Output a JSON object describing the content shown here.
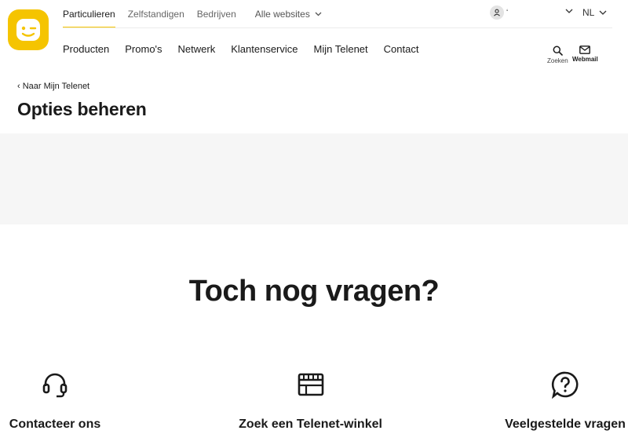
{
  "brand": {
    "accent": "#f5c400",
    "text": "#1a1a1a",
    "band": "#f6f6f6"
  },
  "segments": {
    "items": [
      "Particulieren",
      "Zelfstandigen",
      "Bedrijven"
    ],
    "all_websites": "Alle websites"
  },
  "account": {
    "name": "ʻ"
  },
  "language": "NL",
  "main_nav": [
    "Producten",
    "Promo's",
    "Netwerk",
    "Klantenservice",
    "Mijn Telenet",
    "Contact"
  ],
  "tools": {
    "search": "Zoeken",
    "webmail": "Webmail"
  },
  "page": {
    "back": "‹ Naar Mijn Telenet",
    "title": "Opties beheren"
  },
  "help": {
    "heading": "Toch nog vragen?",
    "cards": [
      {
        "label": "Contacteer ons",
        "icon": "headset-icon"
      },
      {
        "label": "Zoek een Telenet-winkel",
        "icon": "store-icon"
      },
      {
        "label": "Veelgestelde vragen",
        "icon": "question-bubble-icon"
      }
    ]
  }
}
